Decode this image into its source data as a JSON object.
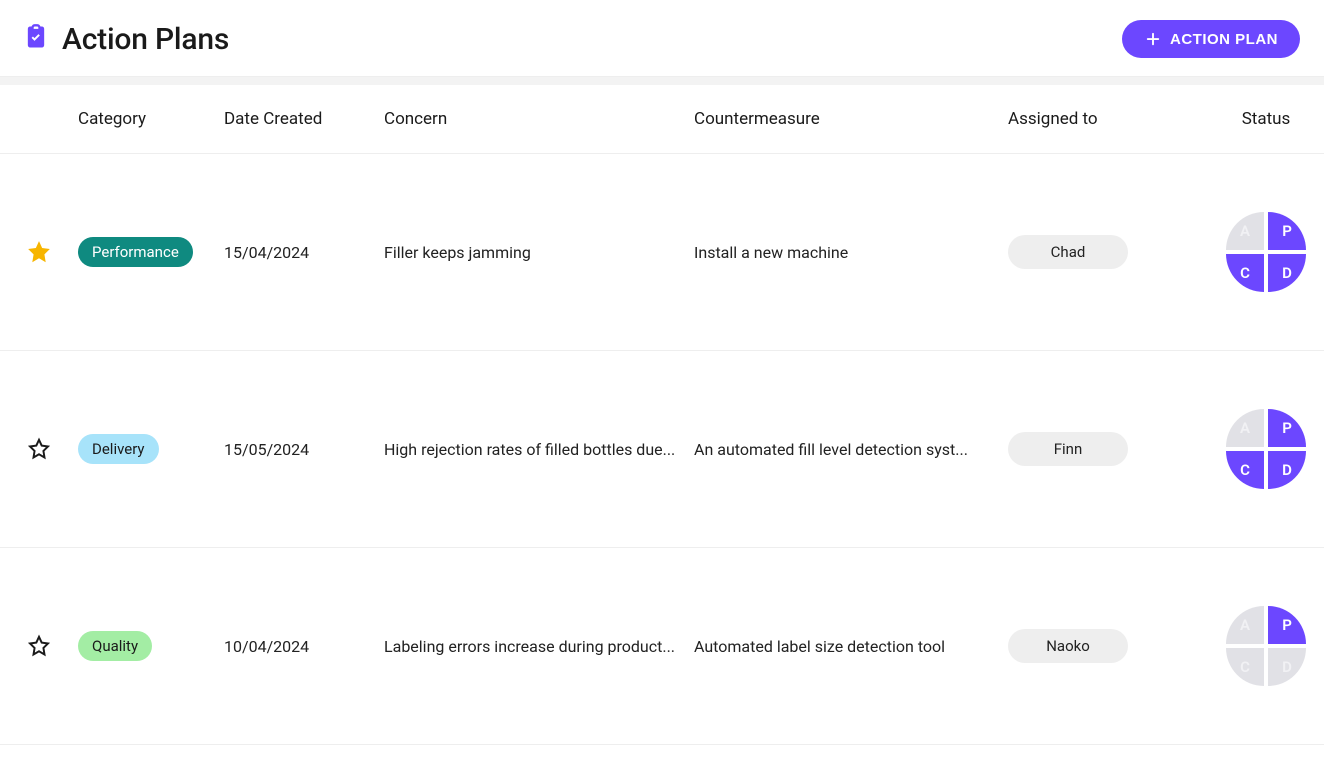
{
  "header": {
    "title": "Action Plans",
    "new_button_label": "ACTION PLAN"
  },
  "columns": {
    "category": "Category",
    "date_created": "Date Created",
    "concern": "Concern",
    "countermeasure": "Countermeasure",
    "assigned_to": "Assigned to",
    "status": "Status"
  },
  "category_colors": {
    "Performance": {
      "bg": "#0F8A80",
      "fg": "#ffffff"
    },
    "Delivery": {
      "bg": "#A7E3FA",
      "fg": "#1a1a1a"
    },
    "Quality": {
      "bg": "#A3EDA4",
      "fg": "#1a1a1a"
    }
  },
  "pdca_letters": {
    "a": "A",
    "p": "P",
    "c": "C",
    "d": "D"
  },
  "rows": [
    {
      "starred": true,
      "category": "Performance",
      "date": "15/04/2024",
      "concern": "Filler keeps jamming",
      "countermeasure": "Install a new machine",
      "assignee": "Chad",
      "pdca_active": [
        "P",
        "C",
        "D"
      ]
    },
    {
      "starred": false,
      "category": "Delivery",
      "date": "15/05/2024",
      "concern": "High rejection rates of filled bottles due...",
      "countermeasure": "An automated fill level detection syst...",
      "assignee": "Finn",
      "pdca_active": [
        "P",
        "C",
        "D"
      ]
    },
    {
      "starred": false,
      "category": "Quality",
      "date": "10/04/2024",
      "concern": "Labeling errors increase during product...",
      "countermeasure": "Automated label size detection tool",
      "assignee": "Naoko",
      "pdca_active": [
        "P"
      ]
    }
  ]
}
